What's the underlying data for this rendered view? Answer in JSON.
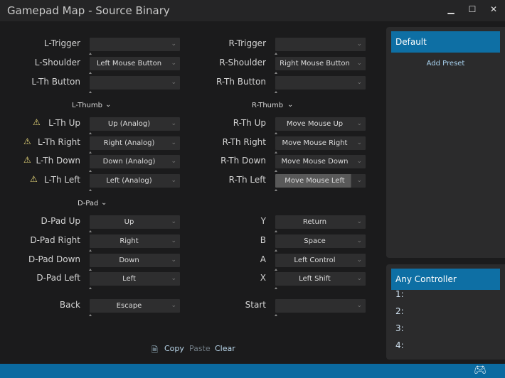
{
  "window": {
    "title": "Gamepad Map - Source Binary",
    "minimize": "▁",
    "maximize": "☐",
    "close": "✕"
  },
  "left": {
    "top": [
      {
        "label": "L-Trigger",
        "value": ""
      },
      {
        "label": "L-Shoulder",
        "value": "Left Mouse Button"
      },
      {
        "label": "L-Th Button",
        "value": ""
      }
    ],
    "thumb_label": "L-Thumb",
    "thumb": [
      {
        "label": "L-Th Up",
        "value": "Up (Analog)",
        "warn": true
      },
      {
        "label": "L-Th Right",
        "value": "Right (Analog)",
        "warn": true
      },
      {
        "label": "L-Th Down",
        "value": "Down (Analog)",
        "warn": true
      },
      {
        "label": "L-Th Left",
        "value": "Left (Analog)",
        "warn": true
      }
    ],
    "dpad_label": "D-Pad",
    "dpad": [
      {
        "label": "D-Pad Up",
        "value": "Up"
      },
      {
        "label": "D-Pad Right",
        "value": "Right"
      },
      {
        "label": "D-Pad Down",
        "value": "Down"
      },
      {
        "label": "D-Pad Left",
        "value": "Left"
      }
    ],
    "back": {
      "label": "Back",
      "value": "Escape"
    }
  },
  "right": {
    "top": [
      {
        "label": "R-Trigger",
        "value": ""
      },
      {
        "label": "R-Shoulder",
        "value": "Right Mouse Button"
      },
      {
        "label": "R-Th Button",
        "value": ""
      }
    ],
    "thumb_label": "R-Thumb",
    "thumb": [
      {
        "label": "R-Th Up",
        "value": "Move Mouse Up"
      },
      {
        "label": "R-Th Right",
        "value": "Move Mouse Right"
      },
      {
        "label": "R-Th Down",
        "value": "Move Mouse Down"
      },
      {
        "label": "R-Th Left",
        "value": "Move Mouse Left",
        "selected": true
      }
    ],
    "buttons": [
      {
        "label": "Y",
        "value": "Return"
      },
      {
        "label": "B",
        "value": "Space"
      },
      {
        "label": "A",
        "value": "Left Control"
      },
      {
        "label": "X",
        "value": "Left Shift"
      }
    ],
    "start": {
      "label": "Start",
      "value": ""
    }
  },
  "actions": {
    "copy": "Copy",
    "paste": "Paste",
    "clear": "Clear"
  },
  "presets": {
    "selected": "Default",
    "add": "Add Preset"
  },
  "controllers": {
    "selected": "Any Controller",
    "slots": [
      "1:",
      "2:",
      "3:",
      "4:"
    ]
  },
  "colors": {
    "accent": "#0e6fa4",
    "warning": "#e8d87a"
  },
  "icons": {
    "warning": "warning-icon",
    "copy": "document-icon",
    "status": "gamepad-icon"
  }
}
